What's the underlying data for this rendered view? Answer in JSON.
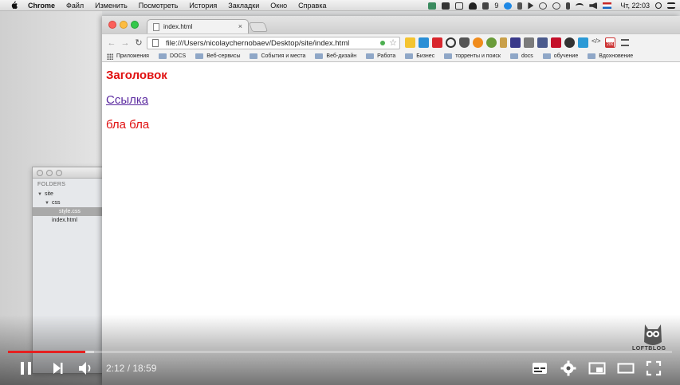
{
  "menubar": {
    "app_name": "Chrome",
    "items": [
      "Файл",
      "Изменить",
      "Посмотреть",
      "История",
      "Закладки",
      "Окно",
      "Справка"
    ],
    "battery_text": "9",
    "clock": "Чт, 22:03"
  },
  "editor": {
    "folders_heading": "FOLDERS",
    "tree": [
      {
        "label": "site",
        "level": 0,
        "expanded": true,
        "selected": false
      },
      {
        "label": "css",
        "level": 1,
        "expanded": true,
        "selected": false
      },
      {
        "label": "style.css",
        "level": 2,
        "expanded": false,
        "selected": true
      },
      {
        "label": "index.html",
        "level": 1,
        "expanded": false,
        "selected": false
      }
    ]
  },
  "browser": {
    "tab_title": "index.html",
    "url": "file:///Users/nicolaychernobaev/Desktop/site/index.html",
    "bookmarks": [
      "Приложения",
      "DOCS",
      "Веб-сервисы",
      "События и места",
      "Веб-дизайн",
      "Работа",
      "Бизнес",
      "торренты и поиск",
      "docs",
      "обучение",
      "Вдохновение"
    ],
    "extension_badge": "206"
  },
  "page": {
    "heading": "Заголовок",
    "link": "Ссылка",
    "paragraph": "бла бла",
    "heading_color": "#e01010",
    "link_color": "#5b2aa0"
  },
  "player": {
    "time": "2:12 / 18:59",
    "progress": 0.116,
    "buffered": 0.13,
    "played_color": "#e52020",
    "logo_text": "LOFTBLOG"
  }
}
